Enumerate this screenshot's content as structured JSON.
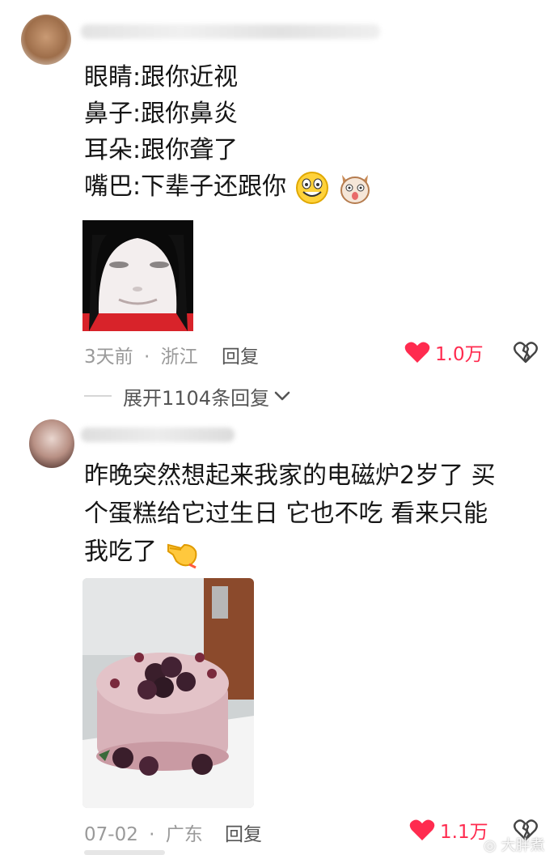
{
  "comments": [
    {
      "lines": [
        "眼睛:跟你近视",
        "鼻子:跟你鼻炎",
        "耳朵:跟你聋了",
        "嘴巴:下辈子还跟你"
      ],
      "time": "3天前",
      "location": "浙江",
      "reply_label": "回复",
      "likes": "1.0万",
      "expand_label": "展开1104条回复"
    },
    {
      "lines": [
        "昨晚突然想起来我家的电磁炉2岁了 买",
        "个蛋糕给它过生日 它也不吃 看来只能",
        "我吃了"
      ],
      "time": "07-02",
      "location": "广东",
      "reply_label": "回复",
      "likes": "1.1万"
    }
  ],
  "separator": "·",
  "watermark": "大胖煮",
  "colors": {
    "like": "#ff2b4f",
    "meta": "#9a9a9a",
    "text": "#161616"
  },
  "icons": [
    "heart-icon",
    "broken-heart-icon",
    "chevron-down-icon",
    "laughing-emoji",
    "dog-emoji",
    "pointing-hand-emoji"
  ]
}
